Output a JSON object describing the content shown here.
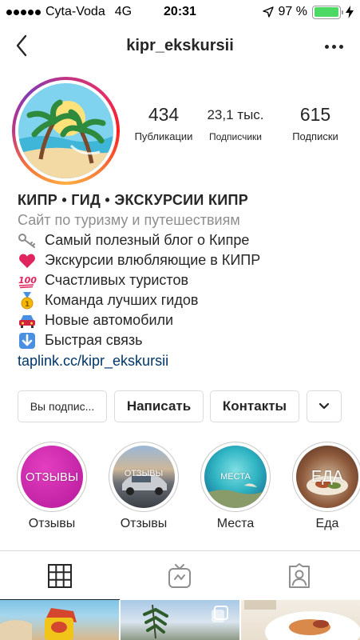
{
  "status_bar": {
    "carrier": "Cyta-Voda",
    "network": "4G",
    "time": "20:31",
    "battery_percent": "97 %",
    "battery_level": 0.97
  },
  "nav": {
    "username": "kipr_ekskursii"
  },
  "stats": {
    "posts": {
      "value": "434",
      "label": "Публикации"
    },
    "followers": {
      "value": "23,1 тыс.",
      "label": "Подписчики"
    },
    "following": {
      "value": "615",
      "label": "Подписки"
    }
  },
  "bio": {
    "name": "КИПР • ГИД • ЭКСКУРСИИ КИПР",
    "category": "Сайт по туризму и путешествиям",
    "lines": [
      {
        "icon": "key-icon",
        "text": "Самый полезный блог о Кипре"
      },
      {
        "icon": "red-heart-icon",
        "text": "Экскурсии влюбляющие в КИПР"
      },
      {
        "icon": "hundred-points-icon",
        "text": "Счастливых туристов"
      },
      {
        "icon": "gold-medal-icon",
        "text": "Команда лучших гидов"
      },
      {
        "icon": "car-icon",
        "text": "Новые автомобили"
      },
      {
        "icon": "down-arrow-icon",
        "text": "Быстрая связь"
      }
    ],
    "link": "taplink.cc/kipr_ekskursii"
  },
  "buttons": {
    "following": "Вы подпис...",
    "message": "Написать",
    "contacts": "Контакты"
  },
  "highlights": [
    {
      "cover_text": "ОТЗЫВЫ",
      "label": "Отзывы"
    },
    {
      "cover_text": "ОТЗЫВЫ",
      "label": "Отзывы"
    },
    {
      "cover_text": "МЕСТА",
      "label": "Места"
    },
    {
      "cover_text": "ЕДА",
      "label": "Еда"
    }
  ],
  "colors": {
    "link": "#003569",
    "secondary_text": "#8e8e8e",
    "battery": "#4cd964",
    "highlight_1": "#c21f9c"
  }
}
